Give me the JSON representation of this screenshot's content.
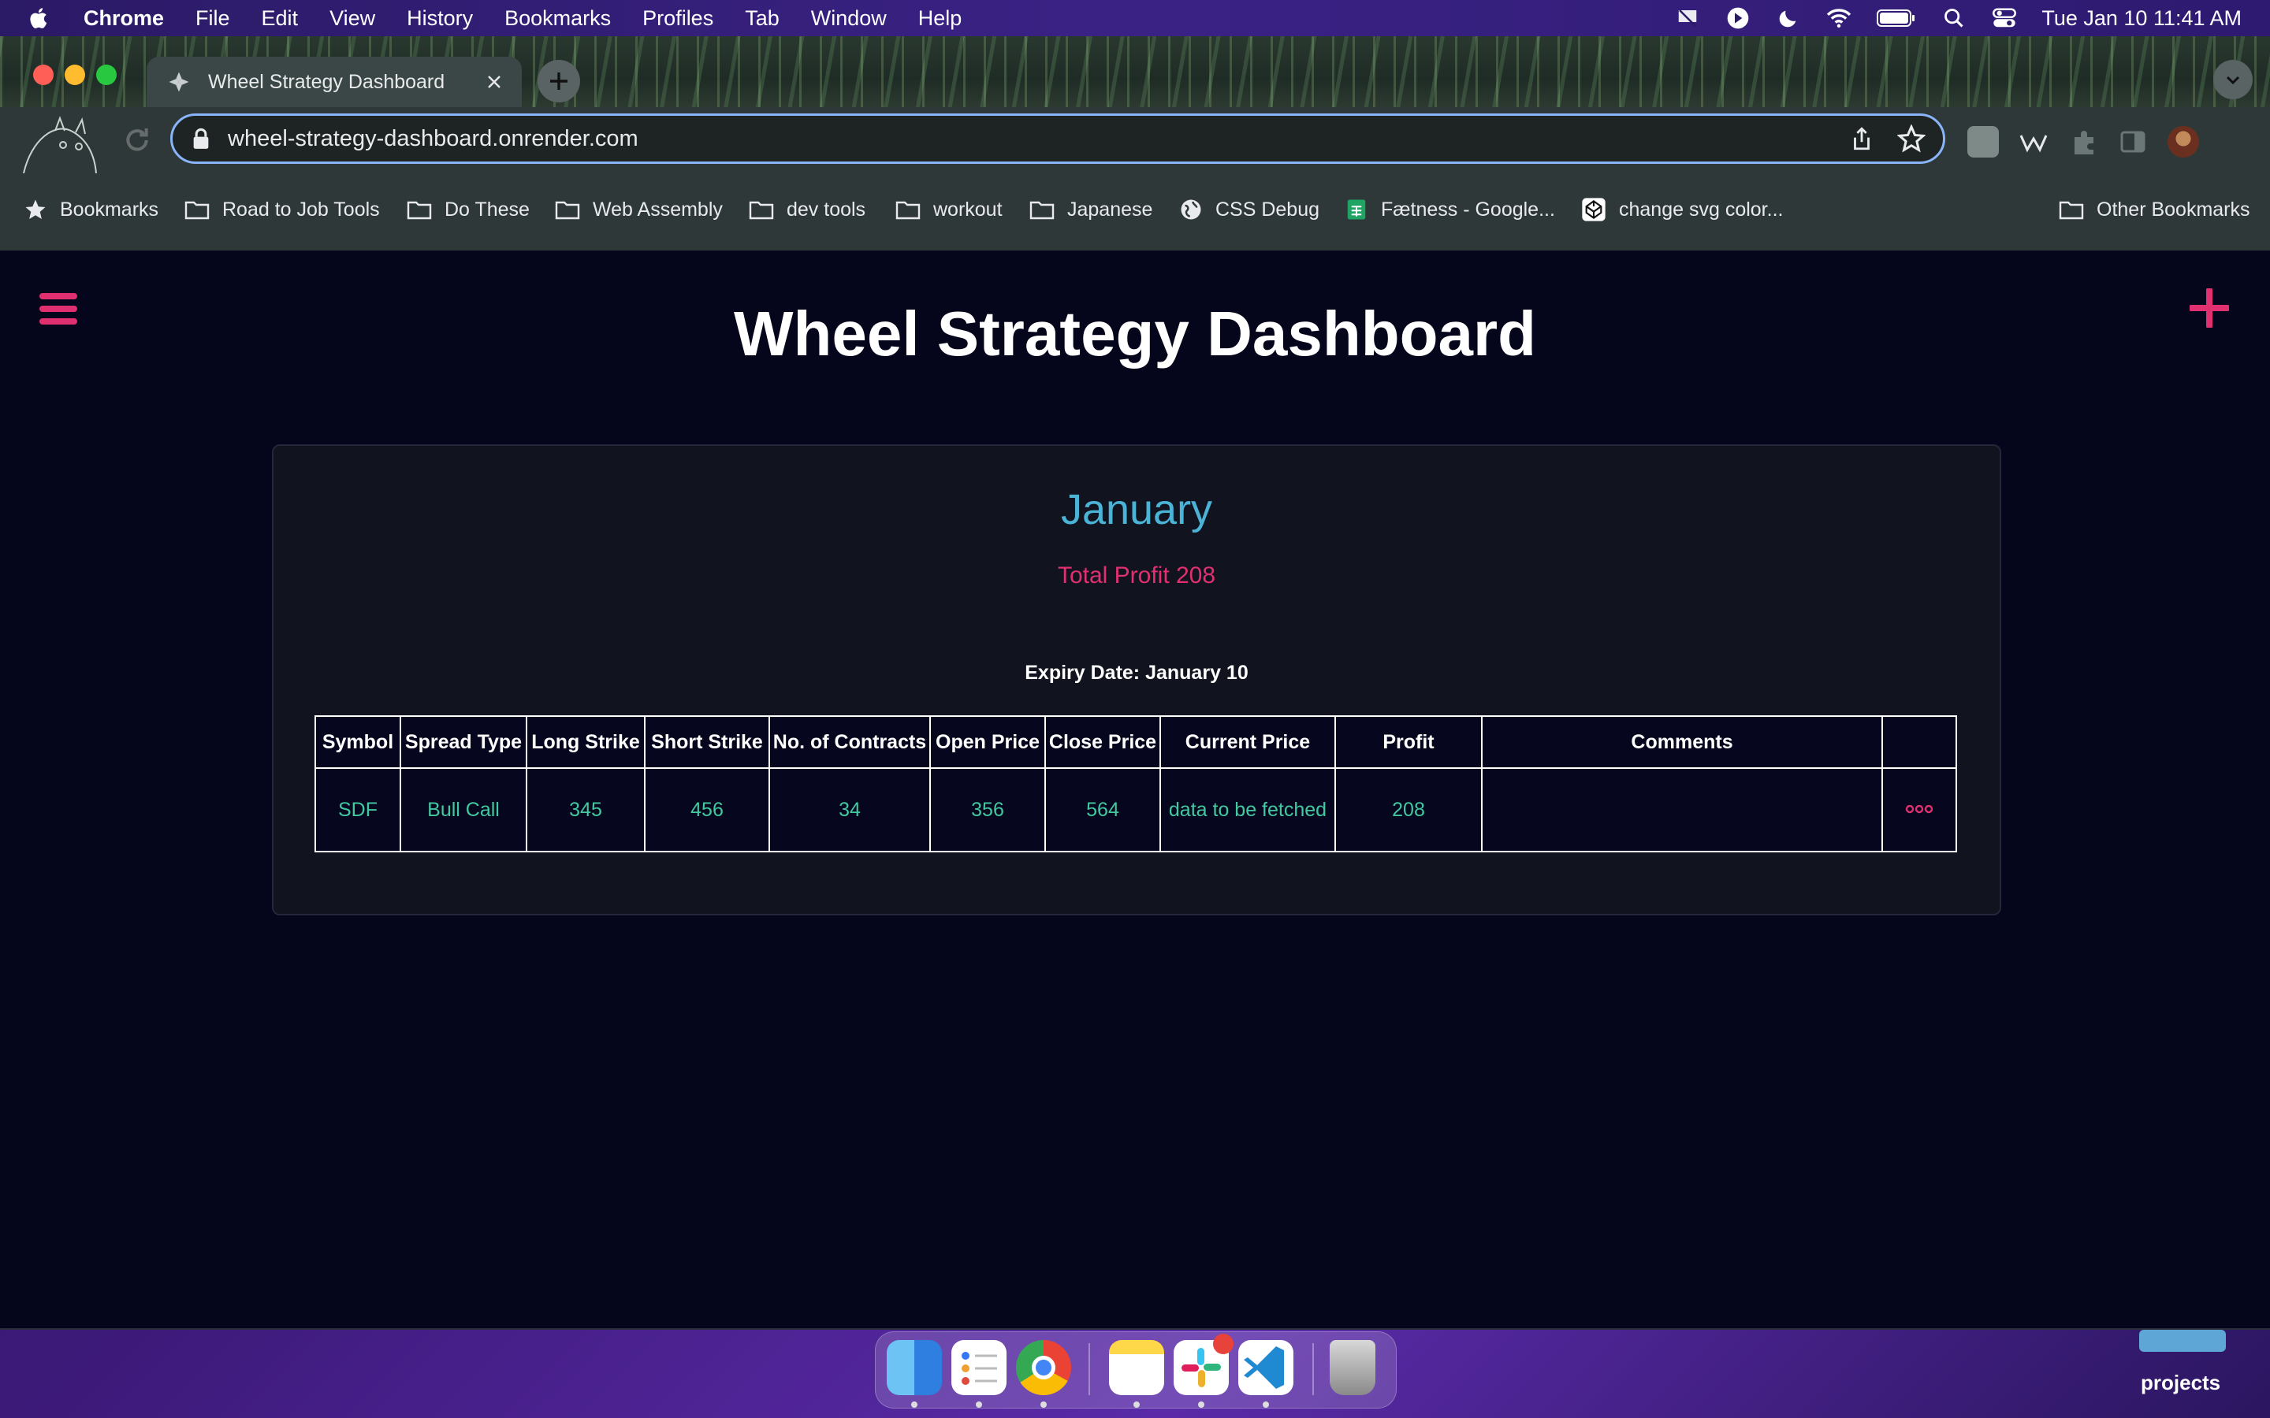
{
  "menubar": {
    "app": "Chrome",
    "items": [
      "File",
      "Edit",
      "View",
      "History",
      "Bookmarks",
      "Profiles",
      "Tab",
      "Window",
      "Help"
    ],
    "clock": "Tue Jan 10  11:41 AM"
  },
  "browser": {
    "tab_title": "Wheel Strategy Dashboard",
    "url": "wheel-strategy-dashboard.onrender.com",
    "bookmarks": [
      {
        "label": "Bookmarks",
        "icon": "star-icon"
      },
      {
        "label": "Road to Job Tools",
        "icon": "folder-icon"
      },
      {
        "label": "Do These",
        "icon": "folder-icon"
      },
      {
        "label": "Web Assembly",
        "icon": "folder-icon"
      },
      {
        "label": "dev tools",
        "icon": "folder-icon"
      },
      {
        "label": "workout",
        "icon": "folder-icon"
      },
      {
        "label": "Japanese",
        "icon": "folder-icon"
      },
      {
        "label": "CSS Debug",
        "icon": "globe-icon"
      },
      {
        "label": "Fætness - Google...",
        "icon": "sheets-icon"
      },
      {
        "label": "change svg color...",
        "icon": "codepen-icon"
      }
    ],
    "other_bookmarks": "Other Bookmarks"
  },
  "page": {
    "title": "Wheel Strategy Dashboard",
    "month": "January",
    "total_profit": "Total Profit 208",
    "expiry": "Expiry Date: January 10",
    "table": {
      "headers": [
        "Symbol",
        "Spread Type",
        "Long Strike",
        "Short Strike",
        "No. of Contracts",
        "Open Price",
        "Close Price",
        "Current Price",
        "Profit",
        "Comments",
        ""
      ],
      "rows": [
        [
          "SDF",
          "Bull Call",
          "345",
          "456",
          "34",
          "356",
          "564",
          "data to be fetched",
          "208",
          ""
        ]
      ]
    }
  },
  "dock": {
    "folder_label": "projects"
  },
  "colors": {
    "accent_pink": "#e0306f",
    "month_blue": "#4ab3d6",
    "cell_green": "#42c9a0",
    "page_bg": "#05051c"
  }
}
